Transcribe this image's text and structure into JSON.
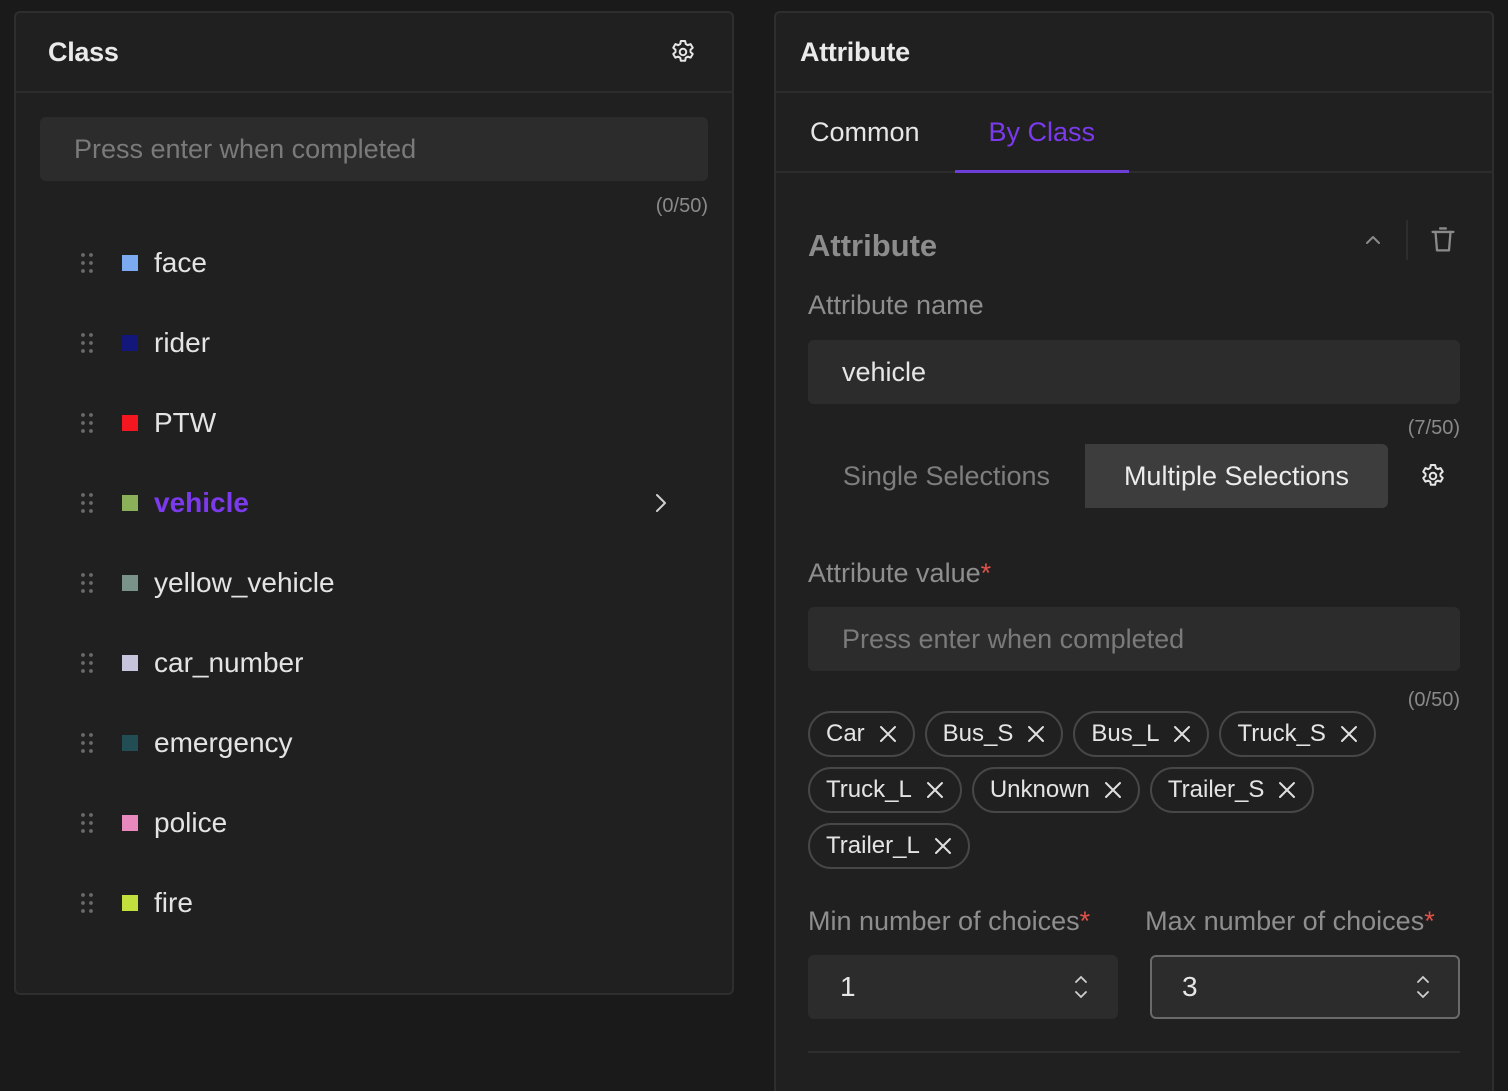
{
  "class_panel": {
    "title": "Class",
    "settings_icon": "gear-icon",
    "input": {
      "placeholder": "Press enter when completed",
      "value": ""
    },
    "counter": "(0/50)",
    "items": [
      {
        "label": "face",
        "color": "#7baaf0",
        "active": false
      },
      {
        "label": "rider",
        "color": "#14177a",
        "active": false
      },
      {
        "label": "PTW",
        "color": "#f51720",
        "active": false
      },
      {
        "label": "vehicle",
        "color": "#8ab05a",
        "active": true
      },
      {
        "label": "yellow_vehicle",
        "color": "#7a938a",
        "active": false
      },
      {
        "label": "car_number",
        "color": "#c6c4dd",
        "active": false
      },
      {
        "label": "emergency",
        "color": "#234d55",
        "active": false
      },
      {
        "label": "police",
        "color": "#e889be",
        "active": false
      },
      {
        "label": "fire",
        "color": "#c2e03d",
        "active": false
      }
    ]
  },
  "attribute_panel": {
    "title": "Attribute",
    "tabs": [
      {
        "label": "Common",
        "active": false
      },
      {
        "label": "By Class",
        "active": true
      }
    ],
    "section": {
      "title": "Attribute",
      "collapse_icon": "chevron-up-icon",
      "delete_icon": "trash-icon",
      "name_label": "Attribute name",
      "name_value": "vehicle",
      "name_counter": "(7/50)",
      "selection_modes": [
        {
          "label": "Single Selections",
          "active": false
        },
        {
          "label": "Multiple Selections",
          "active": true
        }
      ],
      "selection_settings_icon": "gear-icon",
      "value_label": "Attribute value",
      "required_mark": "*",
      "value_input": {
        "placeholder": "Press enter when completed",
        "value": ""
      },
      "value_counter": "(0/50)",
      "values": [
        "Car",
        "Bus_S",
        "Bus_L",
        "Truck_S",
        "Truck_L",
        "Unknown",
        "Trailer_S",
        "Trailer_L"
      ],
      "min_label": "Min number of choices",
      "max_label": "Max number of choices",
      "min_value": "1",
      "max_value": "3"
    }
  },
  "colors": {
    "accent": "#7c3aed",
    "required": "#e0524a",
    "background": "#1a1a1a",
    "panel": "#202020"
  }
}
